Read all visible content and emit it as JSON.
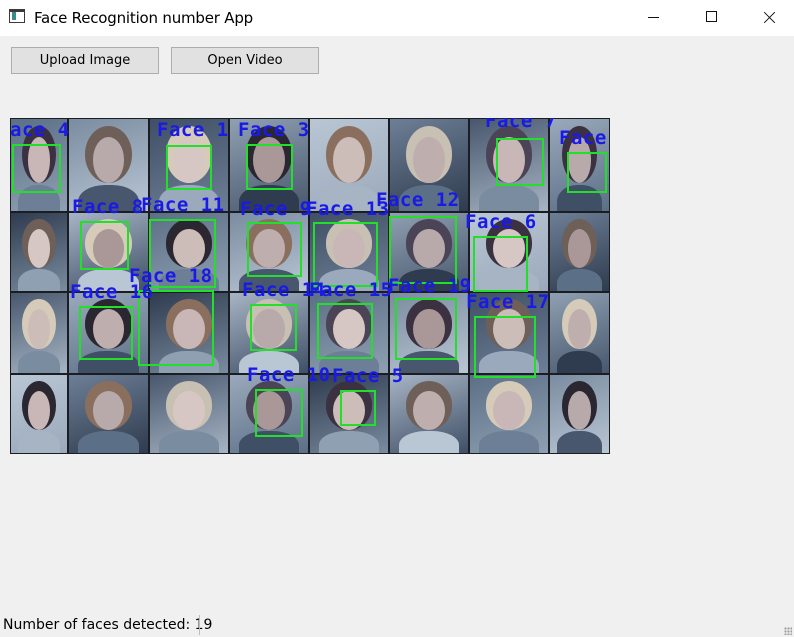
{
  "window": {
    "title": "Face Recognition number App",
    "icon": "app-window-icon"
  },
  "toolbar": {
    "upload_label": "Upload Image",
    "video_label": "Open Video"
  },
  "image": {
    "labels": {
      "f1": "Face 1",
      "f3": "Face 3",
      "f4": "ace 4",
      "f7": "Face 7",
      "f8": "Face",
      "f8b": "Face 8",
      "f11": "Face 11",
      "f9": "Face 9",
      "f13": "Face 13",
      "f12": "Face 12",
      "f6": "Face 6",
      "f18": "Face 18",
      "f16": "Face 16",
      "f14": "Face 14",
      "f15": "Face 15",
      "f19": "Face 19",
      "f17": "Face 17",
      "f10": "Face 10",
      "f5": "Face 5"
    },
    "box_color": "#22e02a",
    "label_color": "#1a1ae6"
  },
  "status": {
    "text": "Number of faces detected: 19"
  }
}
